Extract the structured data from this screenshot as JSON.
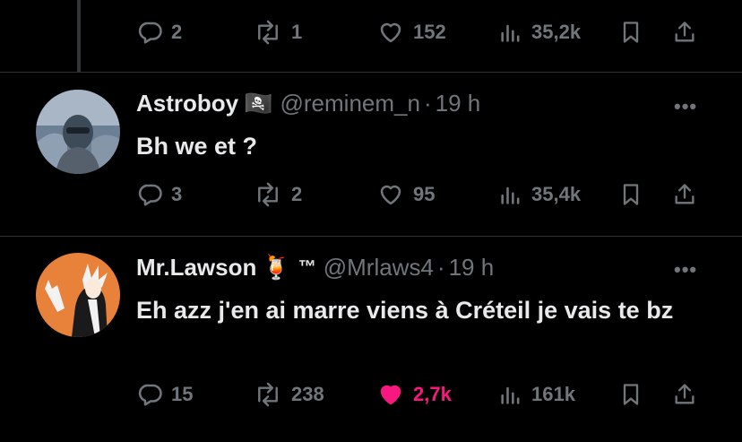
{
  "top_actions": {
    "replies": "2",
    "reposts": "1",
    "likes": "152",
    "views": "35,2k"
  },
  "tweets": [
    {
      "name": "Astroboy",
      "badge": "🏴‍☠️",
      "tm": "",
      "handle": "@reminem_n",
      "time": "19 h",
      "text": "Bh we et ?",
      "replies": "3",
      "reposts": "2",
      "likes": "95",
      "views": "35,4k"
    },
    {
      "name": "Mr.Lawson",
      "badge": "🍹",
      "tm": "™",
      "handle": "@Mrlaws4",
      "time": "19 h",
      "text": "Eh azz j'en ai marre viens à Créteil je vais te bz",
      "replies": "15",
      "reposts": "238",
      "likes": "2,7k",
      "views": "161k",
      "liked": true
    }
  ],
  "colors": {
    "background": "#000000",
    "muted": "#71767b",
    "like": "#f91880",
    "text": "#e7e9ea"
  },
  "more_glyph": "•••",
  "separator": "·"
}
